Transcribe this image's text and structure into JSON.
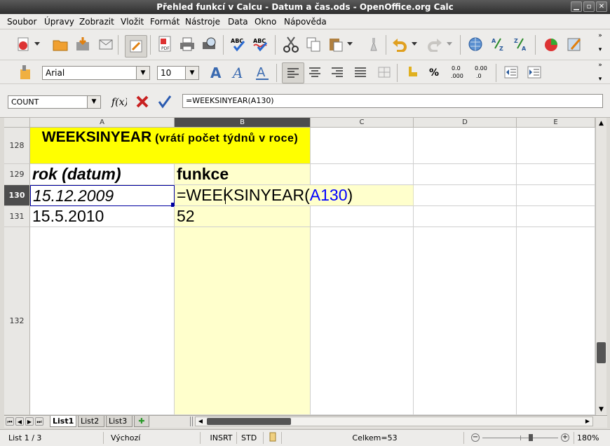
{
  "window": {
    "title": "Přehled funkcí v Calcu - Datum a čas.ods - OpenOffice.org Calc"
  },
  "menu": {
    "items": [
      {
        "label": "Soubor"
      },
      {
        "label": "Úpravy"
      },
      {
        "label": "Zobrazit"
      },
      {
        "label": "Vložit"
      },
      {
        "label": "Formát"
      },
      {
        "label": "Nástroje"
      },
      {
        "label": "Data"
      },
      {
        "label": "Okno"
      },
      {
        "label": "Nápověda"
      }
    ]
  },
  "formatting": {
    "font_name": "Arial",
    "font_size": "10"
  },
  "formula_bar": {
    "name_box": "COUNT",
    "formula": "=WEEKSINYEAR(A130)"
  },
  "columns": [
    "A",
    "B",
    "C",
    "D",
    "E"
  ],
  "rows": {
    "r128": {
      "number": "128",
      "title_bold": "WEEKSINYEAR",
      "title_rest": " (vrátí počet týdnů v roce)"
    },
    "r129": {
      "number": "129",
      "a": "rok (datum)",
      "b": "funkce"
    },
    "r130": {
      "number": "130",
      "a": "15.12.2009",
      "b_prefix": "=WEEKSINYEAR(",
      "b_ref": "A130",
      "b_suffix": ")"
    },
    "r131": {
      "number": "131",
      "a": "15.5.2010",
      "b": "52"
    },
    "r132": {
      "number": "132"
    }
  },
  "sheets": {
    "tabs": [
      {
        "label": "List1"
      },
      {
        "label": "List2"
      },
      {
        "label": "List3"
      }
    ]
  },
  "status": {
    "sheet": "List 1 / 3",
    "style": "Výchozí",
    "insert_mode": "INSRT",
    "selection_mode": "STD",
    "sum": "Celkem=53",
    "zoom": "180%"
  },
  "colors": {
    "title_fill": "#ffff00",
    "highlight_fill": "#ffffcc",
    "ref_color": "#0000ff",
    "selection_border": "#0000a0"
  }
}
